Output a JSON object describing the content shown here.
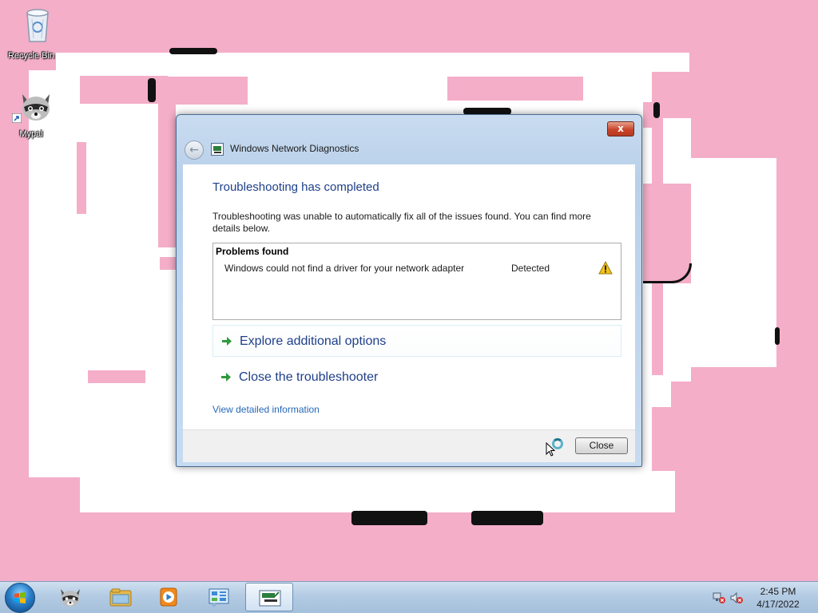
{
  "desktop": {
    "icons": [
      {
        "label": "Recycle Bin",
        "icon": "recycle-bin-icon"
      },
      {
        "label": "Mypal",
        "icon": "raccoon-app-icon"
      }
    ]
  },
  "dialog": {
    "title": "Windows Network Diagnostics",
    "heading": "Troubleshooting has completed",
    "description": "Troubleshooting was unable to automatically fix all of the issues found. You can find more details below.",
    "problems_title": "Problems found",
    "problem": {
      "text": "Windows could not find a driver for your network adapter",
      "status": "Detected",
      "icon": "warning-icon"
    },
    "options": [
      {
        "label": "Explore additional options",
        "icon": "green-arrow-icon"
      },
      {
        "label": "Close the troubleshooter",
        "icon": "green-arrow-icon"
      }
    ],
    "details_link": "View detailed information",
    "close_button": "Close",
    "title_close_glyph": "x"
  },
  "taskbar": {
    "pinned": [
      {
        "icon": "raccoon-app-icon"
      },
      {
        "icon": "file-explorer-icon"
      },
      {
        "icon": "media-player-icon"
      },
      {
        "icon": "control-panel-icon"
      },
      {
        "icon": "network-diagnostics-icon",
        "active": true
      }
    ],
    "tray": [
      {
        "icon": "network-error-icon"
      },
      {
        "icon": "volume-muted-icon"
      }
    ],
    "time": "2:45 PM",
    "date": "4/17/2022"
  },
  "colors": {
    "desktop_background": "#f4aec8",
    "heading_blue": "#1e3f8a",
    "link_blue": "#2768b8",
    "arrow_green": "#2e9a3c",
    "warning_yellow": "#f2c21a"
  }
}
